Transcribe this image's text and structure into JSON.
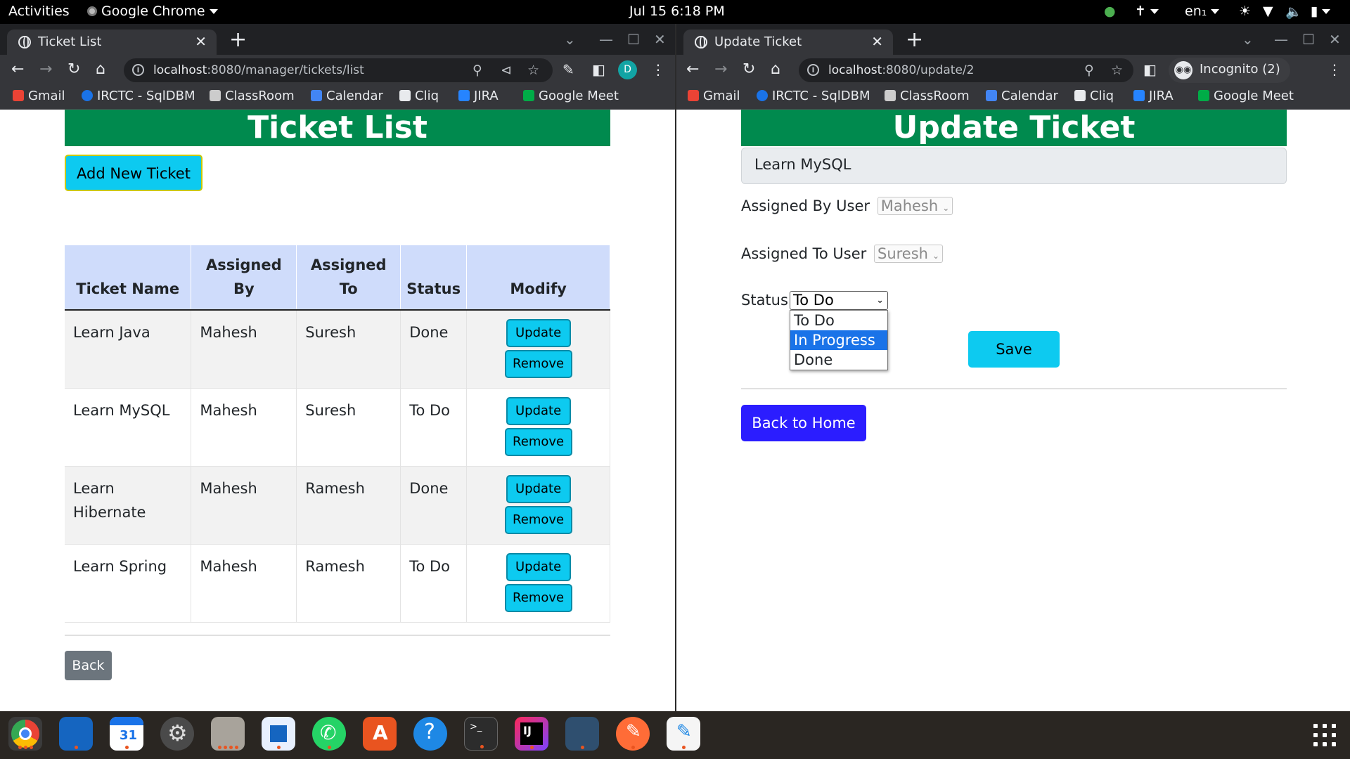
{
  "topbar": {
    "activities": "Activities",
    "app_name": "Google Chrome",
    "datetime": "Jul 15  6:18 PM",
    "language": "en₁"
  },
  "bookmarks": [
    {
      "label": "Gmail",
      "color": "#ea4335"
    },
    {
      "label": "IRCTC - SqlDBM",
      "color": "#1a73e8"
    },
    {
      "label": "ClassRoom",
      "color": "#cccccc"
    },
    {
      "label": "Calendar",
      "color": "#4285f4"
    },
    {
      "label": "Cliq",
      "color": "#e8eaed"
    },
    {
      "label": "JIRA",
      "color": "#2684ff"
    },
    {
      "label": "Google Meet",
      "color": "#00ac47"
    }
  ],
  "left": {
    "tab_title": "Ticket List",
    "url_host": "localhost",
    "url_rest": ":8080/manager/tickets/list",
    "avatar_letter": "D",
    "page_title": "Ticket List",
    "add_button": "Add New Ticket",
    "columns": [
      "Ticket Name",
      "Assigned By",
      "Assigned To",
      "Status",
      "Modify"
    ],
    "rows": [
      {
        "name": "Learn Java",
        "by": "Mahesh",
        "to": "Suresh",
        "status": "Done"
      },
      {
        "name": "Learn MySQL",
        "by": "Mahesh",
        "to": "Suresh",
        "status": "To Do"
      },
      {
        "name": "Learn Hibernate",
        "by": "Mahesh",
        "to": "Ramesh",
        "status": "Done"
      },
      {
        "name": "Learn Spring",
        "by": "Mahesh",
        "to": "Ramesh",
        "status": "To Do"
      }
    ],
    "update_label": "Update",
    "remove_label": "Remove",
    "back_button": "Back"
  },
  "right": {
    "tab_title": "Update Ticket",
    "url_host": "localhost",
    "url_rest": ":8080/update/2",
    "incognito_label": "Incognito (2)",
    "page_title": "Update Ticket",
    "ticket_name_value": "Learn MySQL",
    "assigned_by_label": "Assigned By User",
    "assigned_by_value": "Mahesh",
    "assigned_to_label": "Assigned To User",
    "assigned_to_value": "Suresh",
    "status_label": "Status",
    "status_value": "To Do",
    "status_options": [
      "To Do",
      "In Progress",
      "Done"
    ],
    "status_highlighted": "In Progress",
    "save_button": "Save",
    "back_home_button": "Back to Home"
  },
  "colors": {
    "banner": "#008a4e",
    "cyan_button": "#0dcaf0",
    "blue_button": "#2b1dff",
    "table_header": "#cfdcfb",
    "dropdown_highlight": "#1a73e8"
  },
  "dock": [
    "chrome",
    "chat",
    "calendar",
    "settings",
    "files",
    "writer",
    "whatsapp",
    "app-center",
    "help",
    "terminal",
    "intellij",
    "mysql-workbench",
    "postman",
    "text-editor"
  ]
}
